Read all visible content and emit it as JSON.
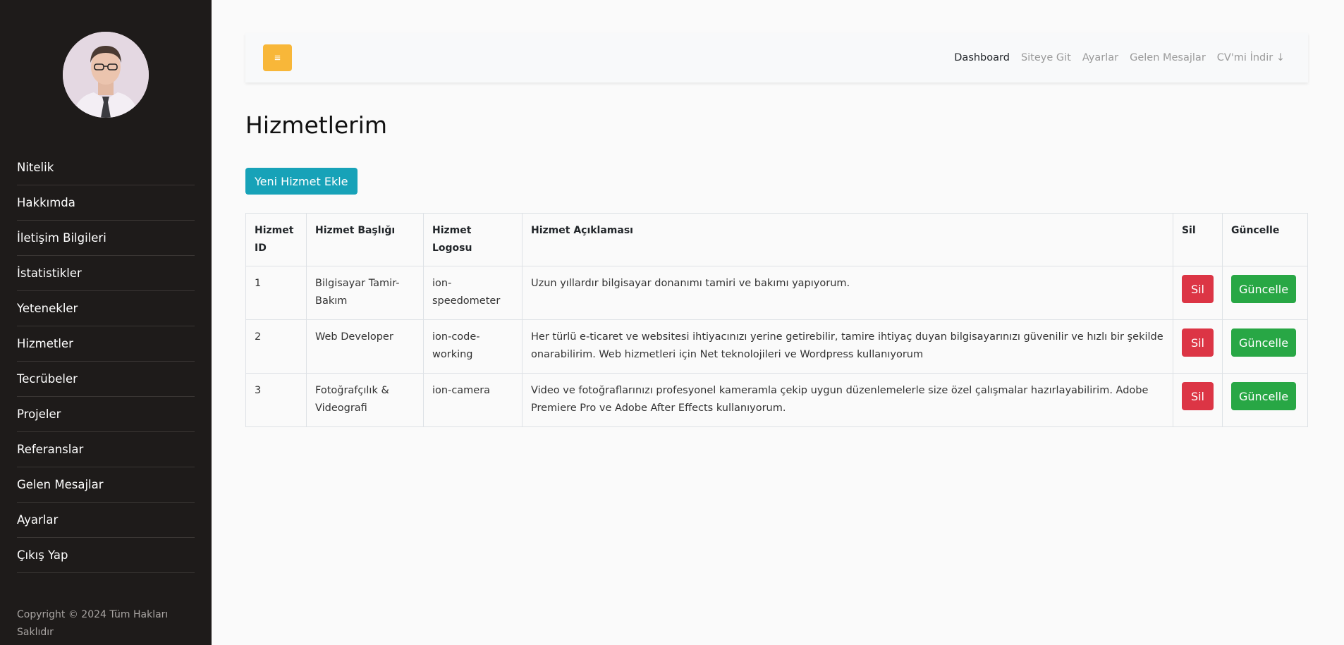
{
  "sidebar": {
    "items": [
      {
        "label": "Nitelik"
      },
      {
        "label": "Hakkımda"
      },
      {
        "label": "İletişim Bilgileri"
      },
      {
        "label": "İstatistikler"
      },
      {
        "label": "Yetenekler"
      },
      {
        "label": "Hizmetler"
      },
      {
        "label": "Tecrübeler"
      },
      {
        "label": "Projeler"
      },
      {
        "label": "Referanslar"
      },
      {
        "label": "Gelen Mesajlar"
      },
      {
        "label": "Ayarlar"
      },
      {
        "label": "Çıkış Yap"
      }
    ],
    "copyright": "Copyright © 2024 Tüm Hakları Saklıdır"
  },
  "topbar": {
    "toggle_icon": "≡",
    "nav": [
      {
        "label": "Dashboard"
      },
      {
        "label": "Siteye Git"
      },
      {
        "label": "Ayarlar"
      },
      {
        "label": "Gelen Mesajlar"
      },
      {
        "label": "CV'mi İndir ↓"
      }
    ]
  },
  "page": {
    "title": "Hizmetlerim",
    "add_button": "Yeni Hizmet Ekle"
  },
  "table": {
    "headers": {
      "id": "Hizmet ID",
      "title": "Hizmet Başlığı",
      "logo": "Hizmet Logosu",
      "description": "Hizmet Açıklaması",
      "delete": "Sil",
      "update": "Güncelle"
    },
    "rows": [
      {
        "id": "1",
        "title": "Bilgisayar Tamir-Bakım",
        "logo": "ion-speedometer",
        "description": "Uzun yıllardır bilgisayar donanımı tamiri ve bakımı yapıyorum.",
        "delete_label": "Sil",
        "update_label": "Güncelle"
      },
      {
        "id": "2",
        "title": "Web Developer",
        "logo": "ion-code-working",
        "description": "Her türlü e-ticaret ve websitesi ihtiyacınızı yerine getirebilir, tamire ihtiyaç duyan bilgisayarınızı güvenilir ve hızlı bir şekilde onarabilirim. Web hizmetleri için Net teknolojileri ve Wordpress kullanıyorum",
        "delete_label": "Sil",
        "update_label": "Güncelle"
      },
      {
        "id": "3",
        "title": "Fotoğrafçılık & Videografi",
        "logo": "ion-camera",
        "description": "Video ve fotoğraflarınızı profesyonel kameramla çekip uygun düzenlemelerle size özel çalışmalar hazırlayabilirim. Adobe Premiere Pro ve Adobe After Effects kullanıyorum.",
        "delete_label": "Sil",
        "update_label": "Güncelle"
      }
    ]
  },
  "colors": {
    "sidebar_bg": "#1e1b1a",
    "toggle_button": "#f8b739",
    "add_button": "#17a2b8",
    "delete_button": "#dc3545",
    "update_button": "#28a745"
  }
}
